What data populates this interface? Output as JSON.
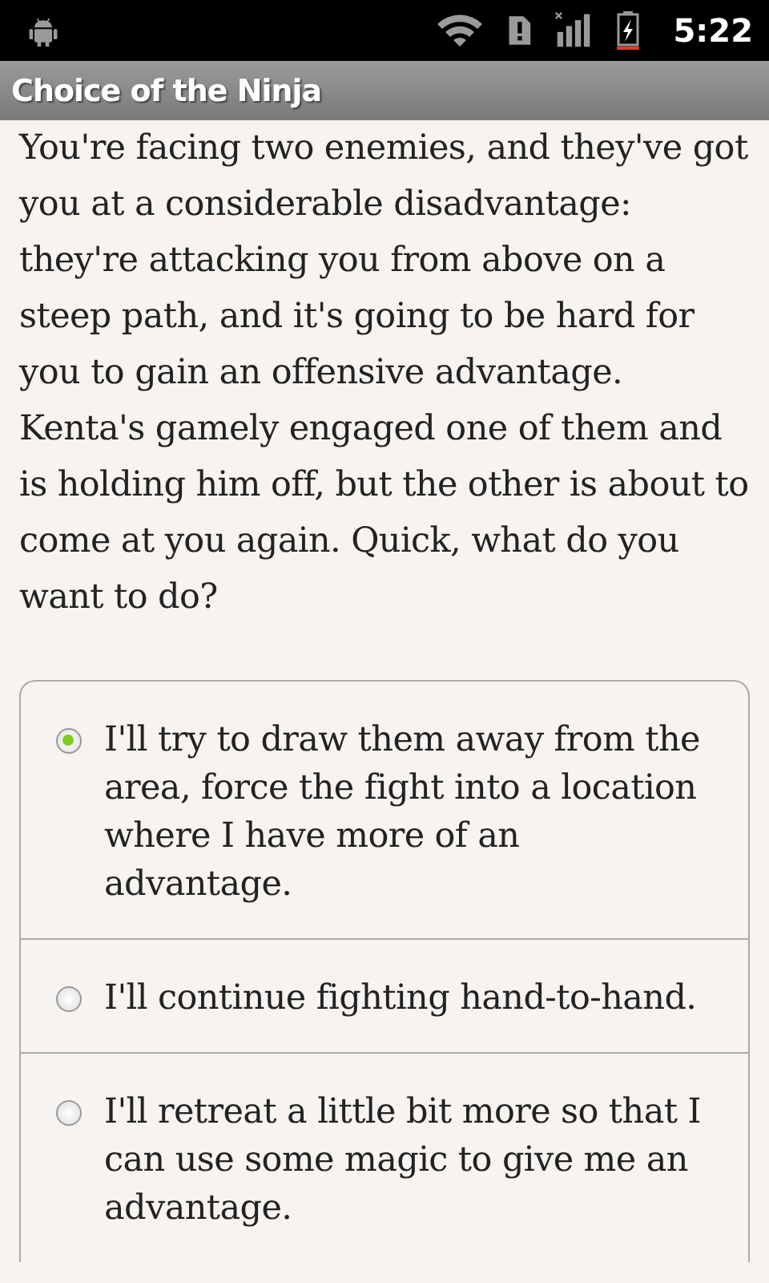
{
  "status_bar": {
    "time": "5:22"
  },
  "window": {
    "title": "Choice of the Ninja"
  },
  "passage": "You're facing two enemies, and they've got you at a considerable disadvantage: they're attacking you from above on a steep path, and it's going to be hard for you to gain an offensive advantage. Kenta's gamely engaged one of them and is holding him off, but the other is about to come at you again. Quick, what do you want to do?",
  "choices": [
    {
      "label": "I'll try to draw them away from the area, force the fight into a location where I have more of an advantage.",
      "selected": true
    },
    {
      "label": "I'll continue fighting hand-to-hand.",
      "selected": false
    },
    {
      "label": "I'll retreat a little bit more so that I can use some magic to give me an advantage.",
      "selected": false
    }
  ]
}
